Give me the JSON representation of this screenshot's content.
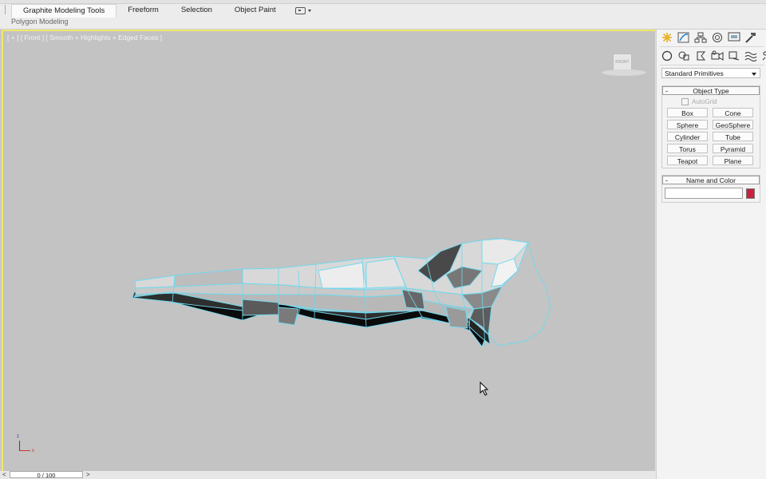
{
  "ribbon": {
    "tabs": [
      {
        "label": "Graphite Modeling Tools",
        "active": true
      },
      {
        "label": "Freeform"
      },
      {
        "label": "Selection"
      },
      {
        "label": "Object Paint"
      }
    ],
    "subtitle": "Polygon Modeling"
  },
  "viewport": {
    "label": "[ + ] [ Front ] [ Smooth + Highlights + Edged Faces ]",
    "viewcube_label": "FRONT",
    "axis_z": "z",
    "axis_x": "x",
    "border_color": "#f2e86a",
    "wire_color": "#6fd9ee"
  },
  "command_panel": {
    "dropdown_value": "Standard Primitives",
    "object_type": {
      "title": "Object Type",
      "autogrid_label": "AutoGrid",
      "buttons": [
        "Box",
        "Cone",
        "Sphere",
        "GeoSphere",
        "Cylinder",
        "Tube",
        "Torus",
        "Pyramid",
        "Teapot",
        "Plane"
      ]
    },
    "name_and_color": {
      "title": "Name and Color",
      "name_value": "",
      "color": "#c8203e"
    },
    "rollout_minus": "-"
  },
  "timeline": {
    "left_arrow": "<",
    "frame_readout": "0 / 100",
    "right_arrow": ">"
  }
}
